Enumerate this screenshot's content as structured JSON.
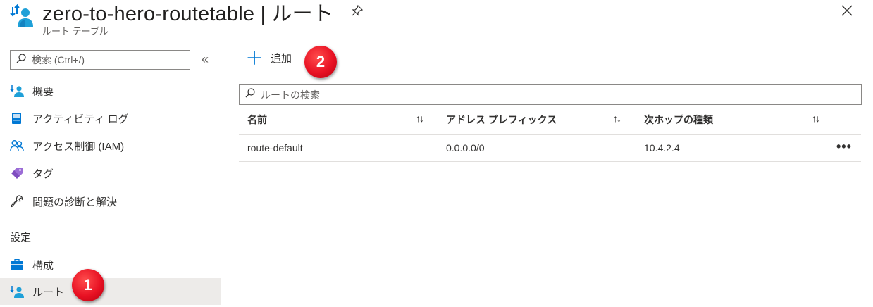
{
  "header": {
    "title": "zero-to-hero-routetable | ルート",
    "subtitle": "ルート テーブル",
    "icons": {
      "resource": "route-table-icon",
      "pin": "pin-icon",
      "close": "close-icon"
    }
  },
  "sidebar": {
    "search_placeholder": "検索 (Ctrl+/)",
    "collapse_glyph": "«",
    "items": [
      {
        "label": "概要",
        "icon": "route-table-icon"
      },
      {
        "label": "アクティビティ ログ",
        "icon": "activity-log-icon"
      },
      {
        "label": "アクセス制御 (IAM)",
        "icon": "iam-icon"
      },
      {
        "label": "タグ",
        "icon": "tag-icon"
      },
      {
        "label": "問題の診断と解決",
        "icon": "wrench-icon"
      }
    ],
    "settings_header": "設定",
    "settings_items": [
      {
        "label": "構成",
        "icon": "configuration-icon"
      },
      {
        "label": "ルート",
        "icon": "route-table-icon",
        "selected": true
      }
    ]
  },
  "toolbar": {
    "add_label": "追加",
    "add_glyph": "＋"
  },
  "route_search": {
    "placeholder": "ルートの検索"
  },
  "table": {
    "columns": [
      "名前",
      "アドレス プレフィックス",
      "次ホップの種類"
    ],
    "sort_glyph": "↑↓",
    "rows": [
      {
        "name": "route-default",
        "address_prefix": "0.0.0.0/0",
        "next_hop": "10.4.2.4",
        "more": "•••"
      }
    ]
  },
  "annotations": {
    "badge1": "1",
    "badge2": "2"
  },
  "colors": {
    "accent": "#0078d4",
    "badge": "#e81123",
    "selected_bg": "#edebe9"
  }
}
